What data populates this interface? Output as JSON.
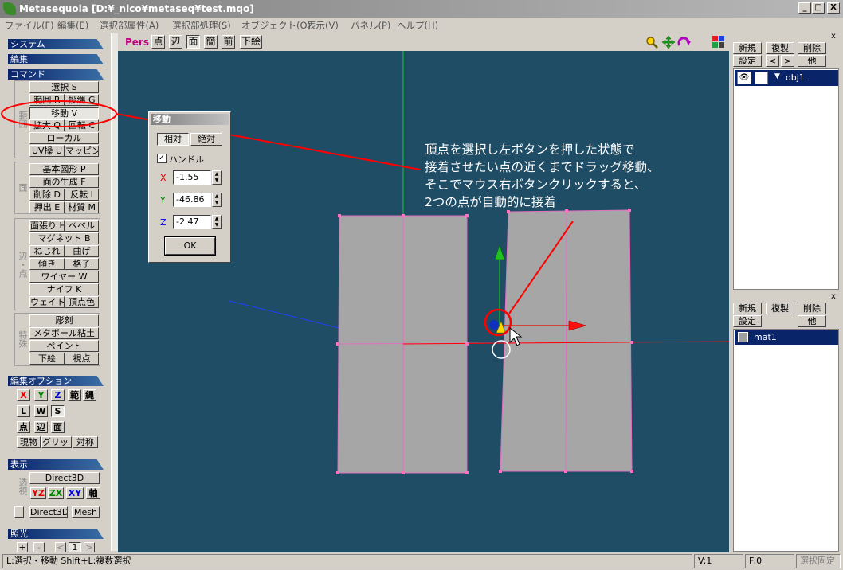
{
  "window": {
    "title": "Metasequoia [D:¥_nico¥metaseq¥test.mqo]",
    "minimize": "_",
    "maximize": "□",
    "close": "X"
  },
  "menu": [
    "ファイル(F)",
    "編集(E)",
    "選択部属性(A)",
    "選択部処理(S)",
    "オブジェクト(O)",
    "表示(V)",
    "パネル(P)",
    "ヘルプ(H)"
  ],
  "left": {
    "system": "システム",
    "edit": "編集",
    "command": "コマンド",
    "select_group_label": "範囲",
    "face_group_label": "面",
    "edge_group_label": "辺・点",
    "special_group_label": "特殊",
    "commands": {
      "select": "選択 S",
      "range": "範囲 R",
      "lasso": "投縄 G",
      "move": "移動 V",
      "scale": "拡大 Q",
      "rotate": "回転 C",
      "local": "ローカル",
      "uv": "UV操 U",
      "mapping": "マッピング"
    },
    "face": {
      "primitive": "基本図形 P",
      "create_face": "面の生成 F",
      "delete": "削除 D",
      "invert": "反転 I",
      "extrude": "押出 E",
      "material": "材質 M"
    },
    "edge": {
      "stretch": "面張り H",
      "bevel": "ベベル",
      "magnet": "マグネット B",
      "twist": "ねじれ",
      "bend": "曲げ",
      "tilt": "傾き",
      "lattice": "格子",
      "wire": "ワイヤー W",
      "knife": "ナイフ K",
      "weight": "ウェイト",
      "vertex_color": "頂点色"
    },
    "special": {
      "sculpt": "彫刻",
      "metaball": "メタボール粘土",
      "paint": "ペイント",
      "trace": "下絵",
      "viewpoint": "視点"
    },
    "edit_options": {
      "title": "編集オプション",
      "x": "X",
      "y": "Y",
      "z": "Z",
      "range": "範",
      "lasso": "縄",
      "l": "L",
      "w": "W",
      "s": "S",
      "point": "点",
      "edge": "辺",
      "face": "面",
      "current": "現物",
      "grid": "グリッド",
      "symmetry": "対称"
    },
    "display": {
      "title": "表示",
      "perspective_label": "透視",
      "direct3d": "Direct3D",
      "yz": "YZ",
      "zx": "ZX",
      "xy": "XY",
      "axis": "軸",
      "direct3d2": "Direct3D",
      "mesh": "Mesh"
    },
    "lighting": {
      "title": "照光",
      "plus": "+",
      "minus": "-",
      "prev": "<",
      "value": "1",
      "next": ">"
    }
  },
  "toolbar": {
    "pers": "Pers",
    "point": "点",
    "edge": "辺",
    "face": "面",
    "simple": "簡",
    "front": "前",
    "trace": "下絵"
  },
  "move_dialog": {
    "title": "移動",
    "relative": "相対",
    "absolute": "絶対",
    "handle_check": "✓",
    "handle": "ハンドル",
    "x_label": "X",
    "x_value": "-1.55",
    "y_label": "Y",
    "y_value": "-46.86",
    "z_label": "Z",
    "z_value": "-2.47",
    "ok": "OK"
  },
  "annotation": {
    "line1": "頂点を選択し左ボタンを押した状態で",
    "line2": "接着させたい点の近くまでドラッグ移動、",
    "line3": "そこでマウス右ボタンクリックすると、",
    "line4": "2つの点が自動的に接着"
  },
  "object_panel": {
    "new": "新規",
    "duplicate": "複製",
    "delete": "削除",
    "settings": "設定",
    "prev": "<",
    "next": ">",
    "other": "他",
    "close": "x",
    "eye": "👁",
    "item": "obj1"
  },
  "material_panel": {
    "new": "新規",
    "duplicate": "複製",
    "delete": "削除",
    "settings": "設定",
    "other": "他",
    "close": "x",
    "item": "mat1"
  },
  "status": {
    "hint": "L:選択・移動  Shift+L:複数選択",
    "vertices": "V:1",
    "faces": "F:0",
    "lock": "選択固定"
  },
  "colors": {
    "viewport_bg": "#1f4d66",
    "mesh_fill": "#a6a6a6",
    "mesh_edge": "#e070c0",
    "annotation_red": "#ff0000"
  }
}
